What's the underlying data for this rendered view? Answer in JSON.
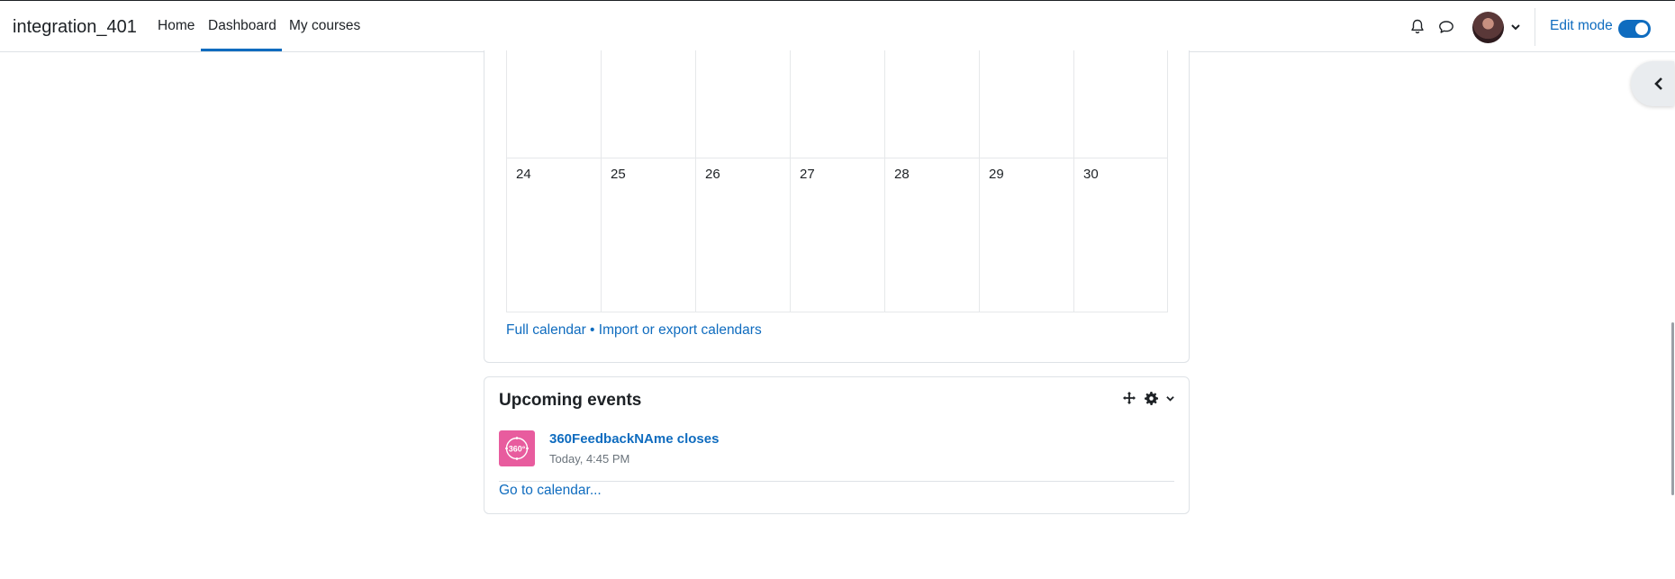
{
  "navbar": {
    "brand": "integration_401",
    "links": [
      {
        "label": "Home"
      },
      {
        "label": "Dashboard"
      },
      {
        "label": "My courses"
      }
    ],
    "active_link": "Dashboard",
    "edit_mode_label": "Edit mode",
    "edit_mode_on": true
  },
  "icons": {
    "notifications": "bell-icon",
    "messages": "chat-bubble-icon",
    "user_menu": "chevron-down-icon",
    "drawer": "chevron-left-icon",
    "move": "move-arrows-icon",
    "settings": "gear-icon",
    "block_menu": "chevron-down-icon",
    "event": "feedback-360-icon"
  },
  "calendar": {
    "last_week_days": [
      "24",
      "25",
      "26",
      "27",
      "28",
      "29",
      "30"
    ],
    "full_calendar_link": "Full calendar",
    "separator": " • ",
    "import_export_link": "Import or export calendars"
  },
  "upcoming_events": {
    "title": "Upcoming events",
    "events": [
      {
        "name": "360FeedbackNAme closes",
        "time": "Today, 4:45 PM"
      }
    ],
    "icon_text": "360°",
    "go_to_calendar": "Go to calendar..."
  },
  "colors": {
    "link": "#0f6cbf",
    "event_icon_bg": "#e85c9e",
    "text": "#1d2125",
    "muted": "#6a737b"
  }
}
